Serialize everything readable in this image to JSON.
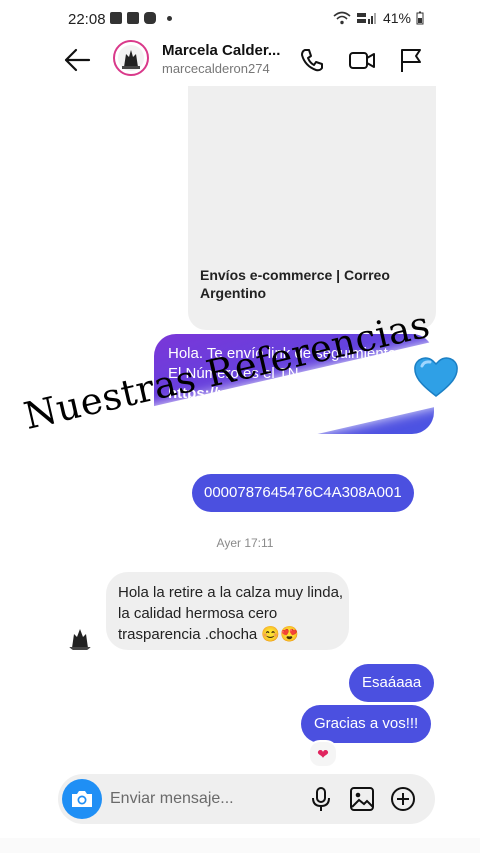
{
  "status_bar": {
    "time": "22:08",
    "battery": "41%"
  },
  "header": {
    "name": "Marcela Calder...",
    "username": "marcecalderon274"
  },
  "messages": {
    "link_card_title": "Envíos e-commerce | Correo Argentino",
    "outgoing_1_line1": "Hola. Te envío link de seguimiento",
    "outgoing_1_line2": "El Número es el TN",
    "outgoing_1_line3": "https://w...",
    "tracking_number": "0000787645476C4A308A001",
    "timestamp": "Ayer 17:11",
    "incoming_1": "Hola la retire a la calza muy linda, la calidad hermosa cero trasparencia .chocha 😊😍",
    "outgoing_2": "Esaáaaa",
    "outgoing_3": "Gracias a vos!!!",
    "reaction": "❤"
  },
  "banner": {
    "text": "Nuestras Referencias"
  },
  "composer": {
    "placeholder": "Enviar mensaje..."
  },
  "icons": [
    "back-arrow-icon",
    "phone-icon",
    "video-icon",
    "flag-icon",
    "camera-icon",
    "microphone-icon",
    "image-icon",
    "plus-icon",
    "heart-icon"
  ],
  "colors": {
    "accent": "#5a48e0",
    "camera": "#1f8ff5",
    "incoming": "#efefef"
  }
}
